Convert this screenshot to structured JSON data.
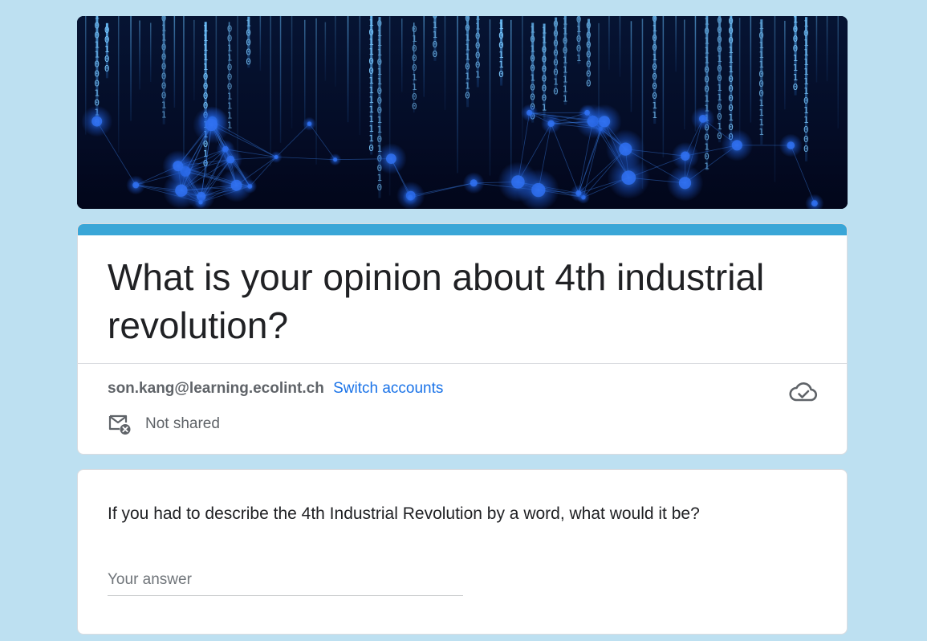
{
  "banner": {
    "image": "binary-code-network-banner",
    "colors": {
      "background": "#030a22",
      "glow": "#1e6fe0",
      "digits": "#5fb9ff"
    }
  },
  "form": {
    "title": "What is your opinion about 4th industrial revolution?",
    "accent_color": "#3aa6d7",
    "page_background": "#bde0f1"
  },
  "account": {
    "email": "son.kang@learning.ecolint.ch",
    "switch_label": "Switch accounts",
    "saved_icon": "cloud-check-icon",
    "sharing_status": "Not shared",
    "sharing_icon": "mail-not-shared-icon"
  },
  "question": {
    "text": "If you had to describe the 4th Industrial Revolution by a word, what would it be?",
    "placeholder": "Your answer",
    "value": ""
  }
}
